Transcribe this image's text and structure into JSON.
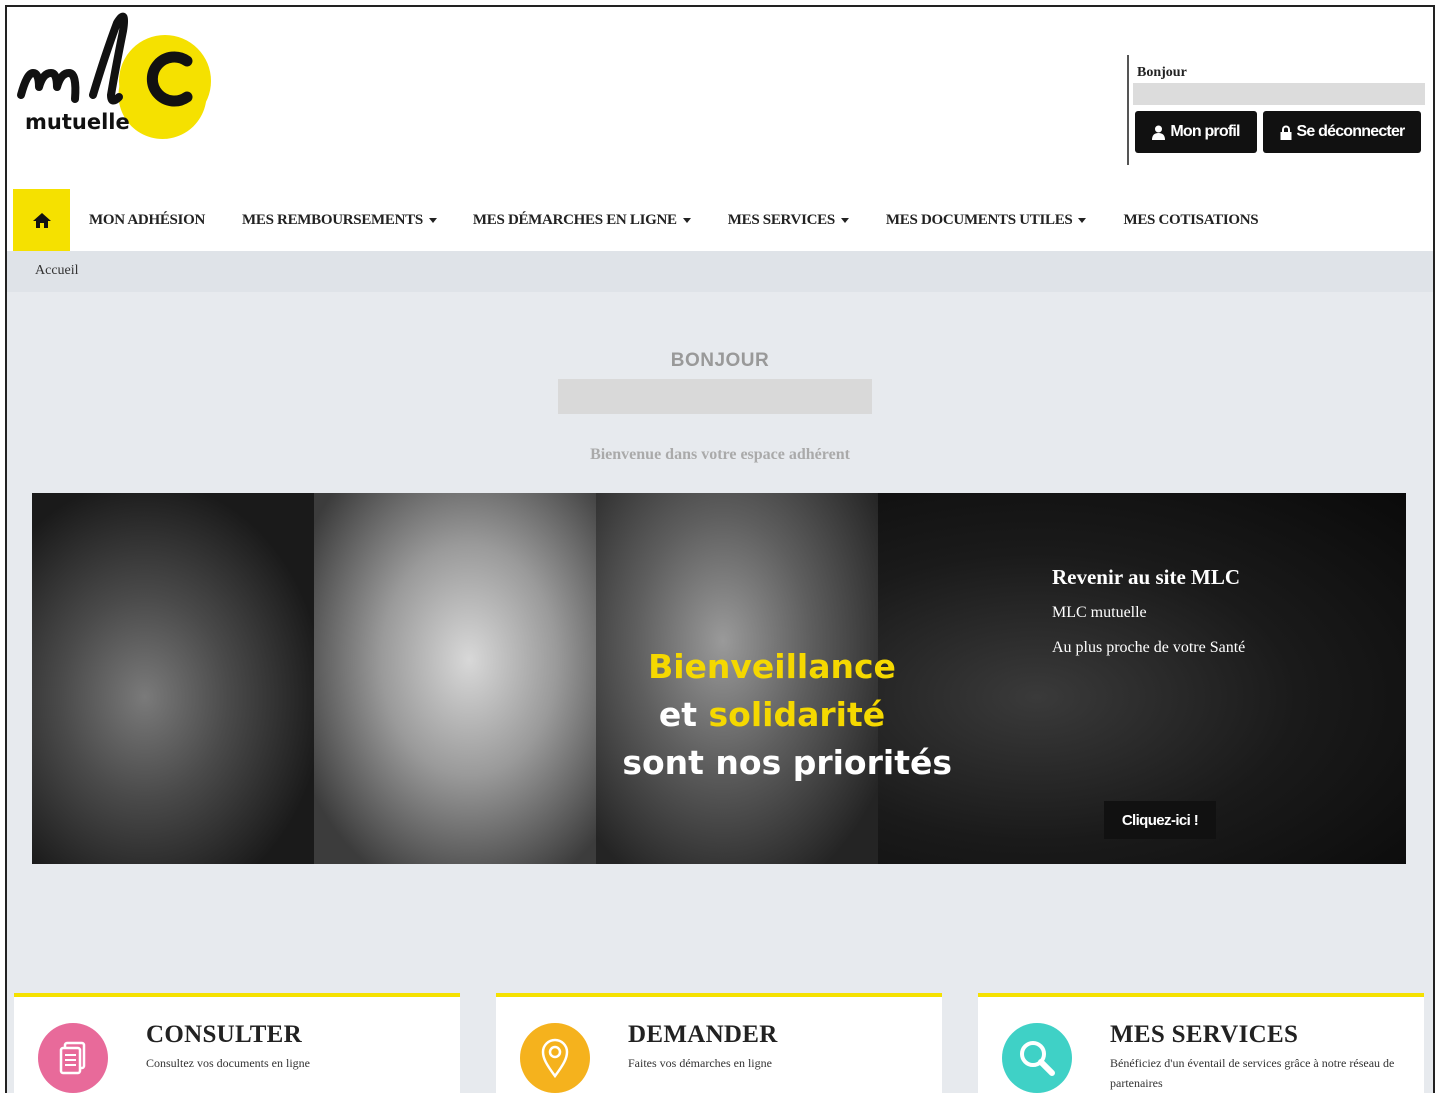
{
  "brand": {
    "logo_text": "mlc",
    "logo_subtext": "mutuelle",
    "accent": "#f5e100"
  },
  "user": {
    "greeting": "Bonjour",
    "profile_label": "Mon profil",
    "logout_label": "Se déconnecter"
  },
  "nav": {
    "home_icon": "home-icon",
    "items": [
      {
        "label": "MON ADHÉSION",
        "dropdown": false
      },
      {
        "label": "MES REMBOURSEMENTS",
        "dropdown": true
      },
      {
        "label": "MES DÉMARCHES EN LIGNE",
        "dropdown": true
      },
      {
        "label": "MES SERVICES",
        "dropdown": true
      },
      {
        "label": "MES DOCUMENTS UTILES",
        "dropdown": true
      },
      {
        "label": "MES COTISATIONS",
        "dropdown": false
      }
    ]
  },
  "breadcrumb": {
    "current": "Accueil"
  },
  "main": {
    "greeting": "BONJOUR",
    "welcome": "Bienvenue dans votre espace adhérent"
  },
  "banner": {
    "slogan_line1": "Bienveillance",
    "slogan_line2_word": "et",
    "slogan_line2_highlight": "solidarité",
    "slogan_line3": "sont nos priorités",
    "promo_title": "Revenir au site MLC",
    "promo_line1": "MLC mutuelle",
    "promo_line2": "Au plus proche de votre Santé",
    "cta_label": "Cliquez-ici !"
  },
  "cards": [
    {
      "title": "CONSULTER",
      "subtitle": "Consultez vos documents en ligne",
      "icon": "document-icon",
      "color": "#e86a9a"
    },
    {
      "title": "DEMANDER",
      "subtitle": "Faites vos démarches en ligne",
      "icon": "location-pin-icon",
      "color": "#f5b21d"
    },
    {
      "title": "MES SERVICES",
      "subtitle": "Bénéficiez d'un éventail de services grâce à notre réseau de partenaires",
      "icon": "search-icon",
      "color": "#3fd1c6"
    }
  ]
}
